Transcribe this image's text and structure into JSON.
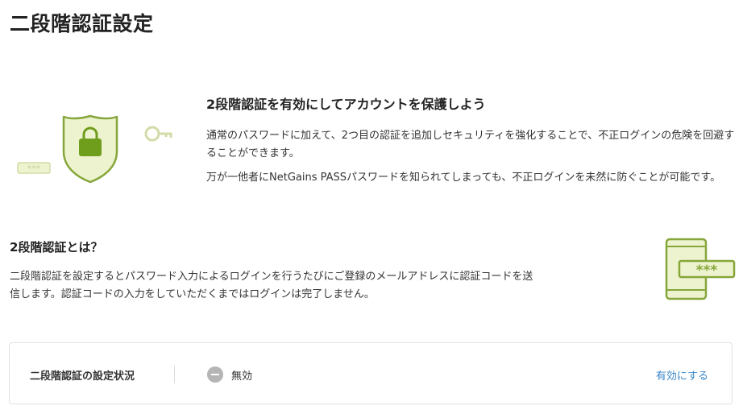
{
  "page": {
    "title": "二段階認証設定"
  },
  "hero": {
    "heading": "2段階認証を有効にしてアカウントを保護しよう",
    "paragraph1": "通常のパスワードに加えて、2つ目の認証を追加しセキュリティを強化することで、不正ログインの危険を回避することができます。",
    "paragraph2": "万が一他者にNetGains PASSパスワードを知られてしまっても、不正ログインを未然に防ぐことが可能です。",
    "illustration": {
      "password_dots": "***",
      "icons": [
        "password-field-icon",
        "shield-lock-icon",
        "key-icon"
      ]
    }
  },
  "about": {
    "heading": "2段階認証とは？",
    "paragraph": "二段階認証を設定するとパスワード入力によるログインを行うたびにご登録のメールアドレスに認証コードを送信します。認証コードの入力をしていただくまではログインは完了しません。",
    "illustration": {
      "code_dots": "***",
      "icons": [
        "phone-code-icon"
      ]
    }
  },
  "status": {
    "label": "二段階認証の設定状況",
    "value": "無効",
    "icon": "minus-circle-icon",
    "action_label": "有効にする"
  },
  "colors": {
    "illustration_stroke": "#86a63a",
    "illustration_fill": "#eef3cf",
    "accent_link": "#3a86c8",
    "status_icon": "#b5b5b5"
  }
}
